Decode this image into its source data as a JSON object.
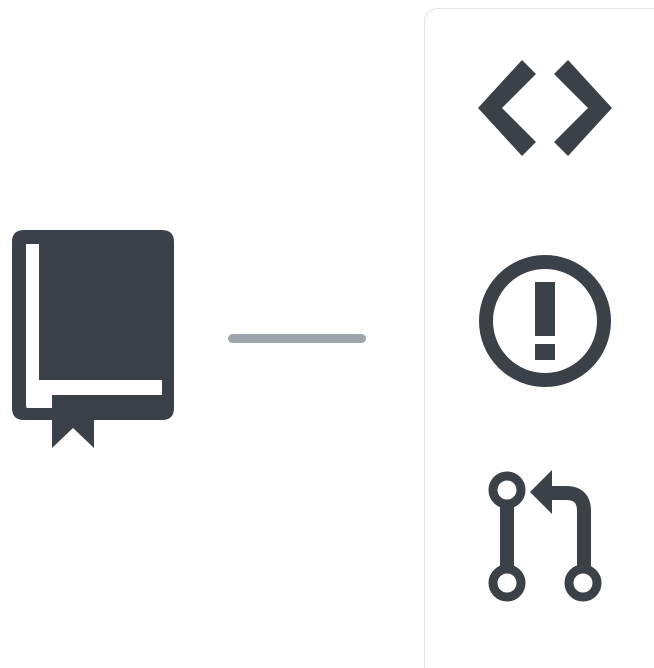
{
  "colors": {
    "icon_fill": "#3b4148",
    "connector": "#9ea4ab",
    "panel_border": "#e3e5e8",
    "background": "#ffffff"
  },
  "icons": {
    "repository": "repo-book-icon",
    "code": "code-angle-brackets-icon",
    "issue": "issue-exclamation-icon",
    "pull_request": "pull-request-icon"
  }
}
